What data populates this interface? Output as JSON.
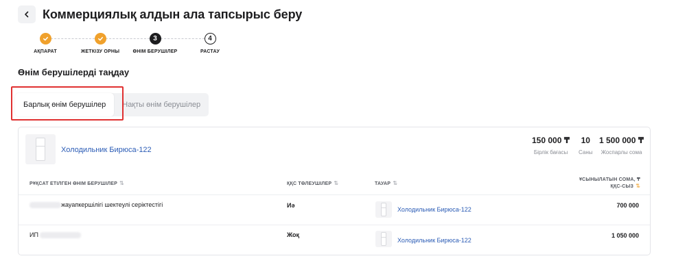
{
  "header": {
    "title": "Коммерциялық алдын ала тапсырыс беру",
    "back_icon": "chevron-left-icon"
  },
  "stepper": {
    "steps": [
      {
        "label": "АҚПАРАТ",
        "status": "done",
        "number": ""
      },
      {
        "label": "ЖЕТКІЗУ ОРНЫ",
        "status": "done",
        "number": ""
      },
      {
        "label": "ӨНІМ БЕРУШІЛЕР",
        "status": "active",
        "number": "3"
      },
      {
        "label": "РАСТАУ",
        "status": "todo",
        "number": "4"
      }
    ]
  },
  "section": {
    "title": "Өнім берушілерді таңдау"
  },
  "tabs": [
    {
      "label": "Барлық өнім берушілер",
      "active": true
    },
    {
      "label": "Нақты өнім берушілер",
      "active": false
    }
  ],
  "product": {
    "name": "Холодильник Бирюса-122",
    "unit_price": "150 000 ₸",
    "unit_price_label": "Бірлік бағасы",
    "quantity": "10",
    "quantity_label": "Саны",
    "planned_sum": "1 500 000 ₸",
    "planned_sum_label": "Жоспарлы сома"
  },
  "table": {
    "headers": {
      "supplier": "РҰҚСАТ ЕТІЛГЕН ӨНІМ БЕРУШІЛЕР",
      "vat": "ҚҚС ТӨЛЕУШІЛЕР",
      "goods": "ТАУАР",
      "sum_line1": "ҰСЫНЫЛАТЫН СОМА, ₸",
      "sum_line2": "ҚҚС-СЫЗ"
    },
    "rows": [
      {
        "supplier": "жауапкершілігі шектеулі серіктестігі",
        "vat": "Иә",
        "goods": "Холодильник Бирюса-122",
        "sum": "700 000"
      },
      {
        "supplier": "ИП",
        "vat": "Жоқ",
        "goods": "Холодильник Бирюса-122",
        "sum": "1 050 000"
      }
    ]
  },
  "colors": {
    "accent": "#f0a12c",
    "link": "#2a5bb5",
    "highlight": "#e03030"
  }
}
